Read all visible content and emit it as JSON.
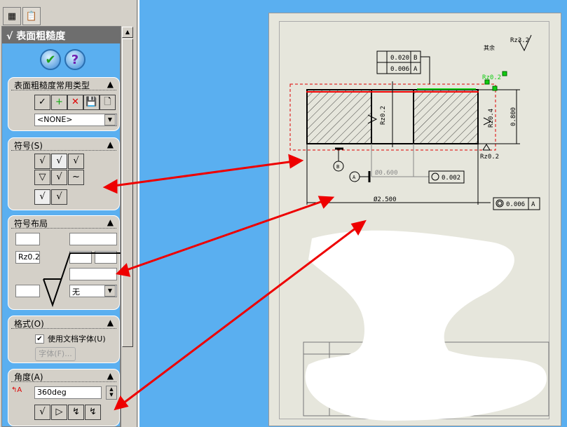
{
  "panel": {
    "title": "表面粗糙度",
    "ok": "✔",
    "help": "?",
    "common": {
      "title": "表面粗糙度常用类型",
      "select": "<NONE>"
    },
    "symbol": {
      "title": "符号(S)",
      "items": [
        "√",
        "√",
        "√",
        "▽",
        "√",
        "~",
        "√",
        "√"
      ]
    },
    "layout": {
      "title": "符号布局",
      "rz": "Rz0.2",
      "lay": "无"
    },
    "format": {
      "title": "格式(O)",
      "checkbox": "使用文档字体(U)",
      "font_btn": "字体(F)..."
    },
    "angle": {
      "title": "角度(A)",
      "value": "360deg"
    }
  },
  "drawing": {
    "corner_rz": "Rz3.2",
    "corner_note": "其余",
    "fc1_tol": "0.020",
    "fc1_ref": "B",
    "fc2_tol": "0.006",
    "fc2_ref": "A",
    "rz_green": "Rz0.2",
    "rz_mid": "Rz0.2",
    "rz_right": "Rz0.4",
    "rz_bottom": "Rz0.2",
    "dim_h": "0.800",
    "datum_b": "B",
    "datum_a": "A",
    "dia_small": "Ø0.600",
    "circ_tol": "0.002",
    "dia_large": "Ø2.500",
    "conc_tol": "0.006",
    "conc_ref": "A"
  }
}
